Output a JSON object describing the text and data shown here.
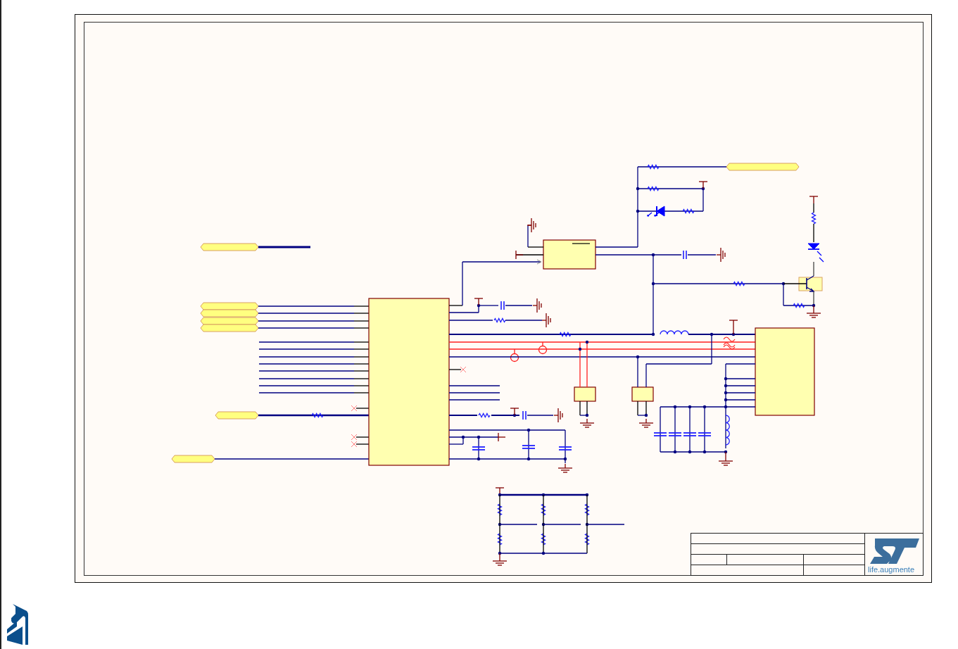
{
  "sheet": {
    "title_block": {
      "logo_tagline": "life.augmente"
    }
  }
}
